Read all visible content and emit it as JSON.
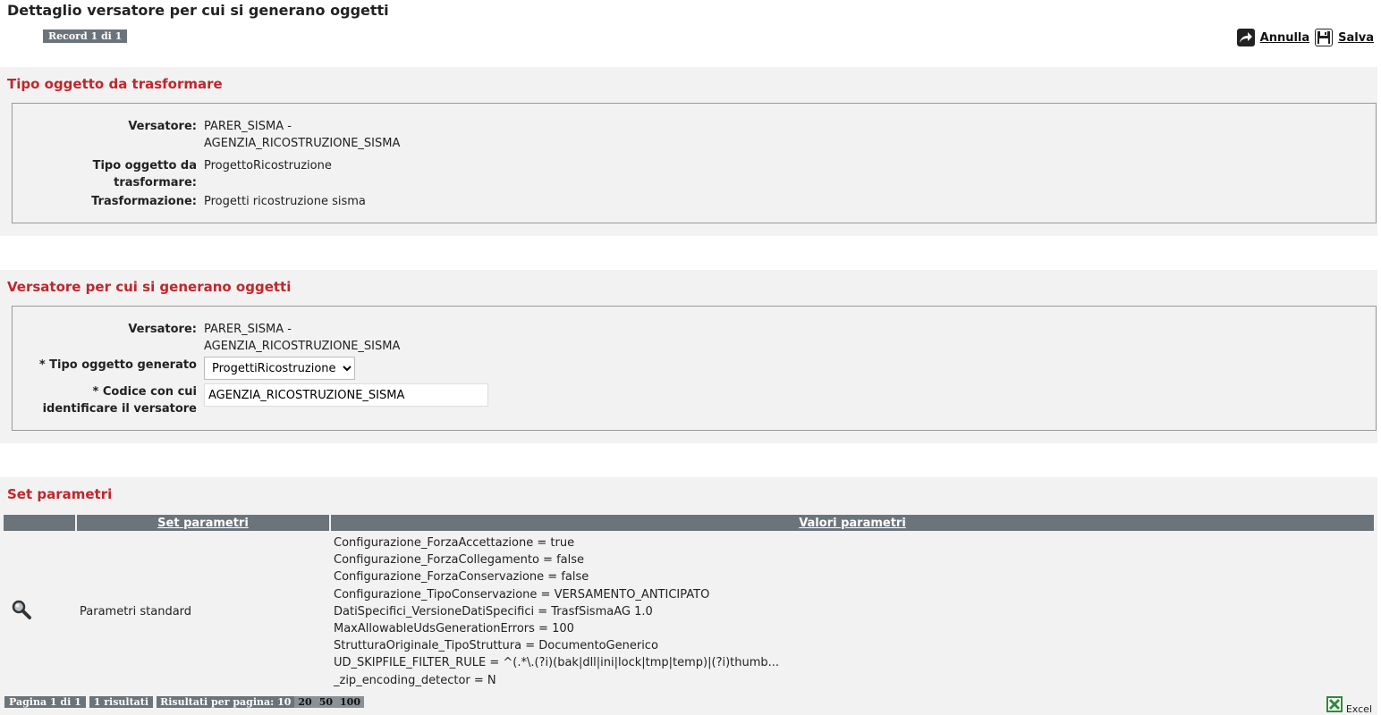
{
  "page": {
    "title": "Dettaglio versatore per cui si generano oggetti",
    "record": "Record 1 di 1"
  },
  "actions": {
    "cancel_label": "Annulla",
    "save_label": "Salva"
  },
  "section1": {
    "title": "Tipo oggetto da trasformare",
    "versatore_label": "Versatore:",
    "versatore_line1": "PARER_SISMA -",
    "versatore_line2": "AGENZIA_RICOSTRUZIONE_SISMA",
    "tipo_label_1": "Tipo oggetto da",
    "tipo_label_2": "trasformare:",
    "tipo_value": "ProgettoRicostruzione",
    "trasf_label": "Trasformazione:",
    "trasf_value": "Progetti ricostruzione sisma"
  },
  "section2": {
    "title": "Versatore per cui si generano oggetti",
    "versatore_label": "Versatore:",
    "versatore_line1": "PARER_SISMA -",
    "versatore_line2": "AGENZIA_RICOSTRUZIONE_SISMA",
    "tipo_generato_label": "* Tipo oggetto generato",
    "tipo_generato_value": "ProgettiRicostruzione",
    "codice_label_1": "* Codice con cui",
    "codice_label_2": "identificare il versatore",
    "codice_value": "AGENZIA_RICOSTRUZIONE_SISMA"
  },
  "section3": {
    "title": "Set parametri",
    "columns": [
      "",
      "Set parametri",
      "Valori parametri"
    ],
    "rows": [
      {
        "set_name": "Parametri standard",
        "values": [
          "Configurazione_ForzaAccettazione = true",
          "Configurazione_ForzaCollegamento = false",
          "Configurazione_ForzaConservazione = false",
          "Configurazione_TipoConservazione = VERSAMENTO_ANTICIPATO",
          "DatiSpecifici_VersioneDatiSpecifici = TrasfSismaAG 1.0",
          "MaxAllowableUdsGenerationErrors = 100",
          "StrutturaOriginale_TipoStruttura = DocumentoGenerico",
          "UD_SKIPFILE_FILTER_RULE = ^(.*\\.(?i)(bak|dll|ini|lock|tmp|temp)|(?i)thumb...",
          "_zip_encoding_detector = N"
        ]
      }
    ]
  },
  "pager": {
    "page": "Pagina 1 di 1",
    "results": "1 risultati",
    "per_page_label": "Risultati per pagina: 10",
    "sizes": [
      "20",
      "50",
      "100"
    ]
  },
  "export": {
    "excel_label": "Excel"
  },
  "colors": {
    "accent": "#c0262c",
    "header_bg": "#6b747a",
    "panel_bg": "#f2f2f2"
  },
  "icons": {
    "cancel": "share-arrow-icon",
    "save": "floppy-disk-icon",
    "detail": "magnifier-icon",
    "excel": "excel-icon"
  }
}
